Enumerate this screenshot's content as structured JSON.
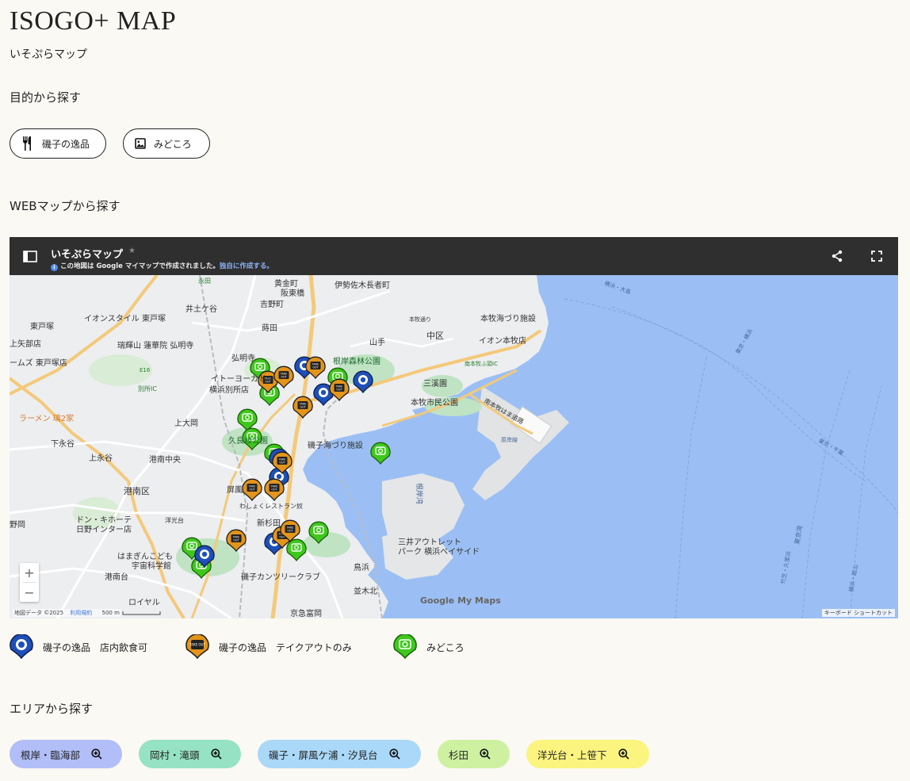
{
  "header": {
    "title": "ISOGO+ MAP",
    "subtitle": "いそぷらマップ"
  },
  "purpose": {
    "heading": "目的から探す",
    "buttons": [
      {
        "label": "磯子の逸品",
        "icon": "fork-knife-icon"
      },
      {
        "label": "みどころ",
        "icon": "image-icon"
      }
    ]
  },
  "webmap": {
    "heading": "WEBマップから探す",
    "map": {
      "title": "いそぷらマップ",
      "note": "この地図は Google マイマップで作成されました。",
      "note_link": "独自に作成する。",
      "attribution": "地図データ ©2025",
      "terms": "利用規約",
      "scale": "500 m",
      "keyboard": "キーボード ショートカット",
      "logo": "Google My Maps",
      "zoom_in": "+",
      "zoom_out": "−",
      "labels": [
        "永田",
        "黄金町",
        "阪東橋",
        "伊勢佐木長者町",
        "井土ケ谷",
        "吉野町",
        "東戸塚",
        "イオンスタイル 東戸塚",
        "上矢部店",
        "瑞輝山 蓮華院 弘明寺",
        "弘明寺",
        "ームズ 東戸塚店",
        "イトーヨーカドー",
        "横浜別所店",
        "別所IC",
        "E16",
        "蒔田",
        "山手",
        "中区",
        "根岸森林公園",
        "本牧海づり施設",
        "イオン本牧店",
        "本牧通り",
        "三溪園",
        "本牧市民公園",
        "南本牧ふ頭IC",
        "南本牧はま道路",
        "横浜・大島",
        "東京・横浜",
        "根岸湾",
        "磯子海づり施設",
        "ラーメン 璃2家",
        "上大岡",
        "下永谷",
        "上永谷",
        "港南中央",
        "港南区",
        "屏風",
        "久良岐公園",
        "わしょくレストラン奴",
        "野岡",
        "ドン・キホーテ",
        "日野インター店",
        "洋光台",
        "新杉田",
        "はまぎんこども",
        "宇宙科学館",
        "港南台",
        "ロイヤル",
        "磯子カンツリークラブ",
        "三井アウトレット",
        "パーク 横浜ベイサイド",
        "鳥浜",
        "並木北",
        "京急富岡",
        "原岸線",
        "東京・千葉",
        "竹芝・久里浜",
        "横浜・館山",
        "東京湾"
      ]
    }
  },
  "legend": {
    "items": [
      {
        "label": "磯子の逸品　店内飲食可",
        "icon": "dine-in-marker-icon",
        "color": "#1f4fb8"
      },
      {
        "label": "磯子の逸品　テイクアウトのみ",
        "icon": "takeout-marker-icon",
        "color": "#e3951b"
      },
      {
        "label": "みどころ",
        "icon": "camera-marker-icon",
        "color": "#3fc81c"
      }
    ],
    "takeout_text": "TAKE OUT"
  },
  "area": {
    "heading": "エリアから探す",
    "chips": [
      {
        "label": "根岸・臨海部",
        "color": "#b2bef8"
      },
      {
        "label": "岡村・滝頭",
        "color": "#95e3c4"
      },
      {
        "label": "磯子・屏風ケ浦・汐見台",
        "color": "#aad8f8"
      },
      {
        "label": "杉田",
        "color": "#cdf1a1"
      },
      {
        "label": "洋光台・上笹下",
        "color": "#fbf47f"
      }
    ]
  }
}
